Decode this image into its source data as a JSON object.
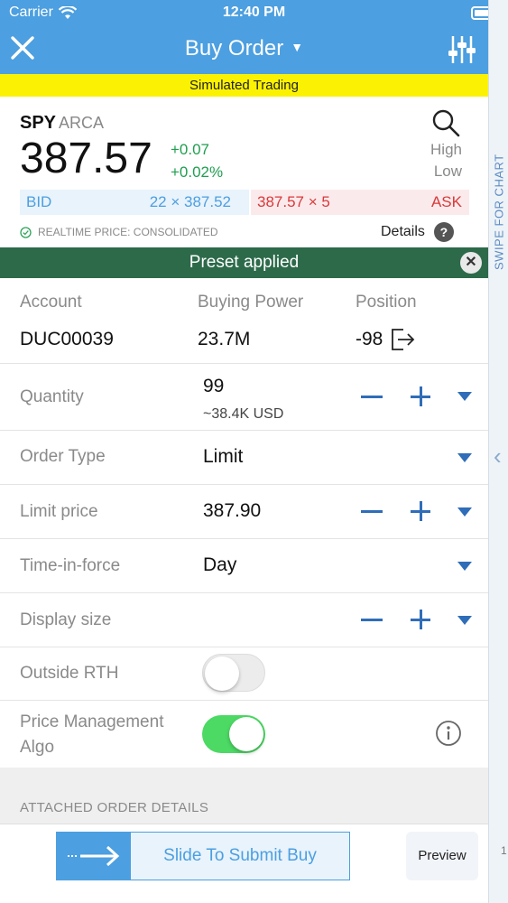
{
  "status_bar": {
    "carrier": "Carrier",
    "time": "12:40 PM"
  },
  "header": {
    "title": "Buy Order",
    "banner": "Simulated Trading"
  },
  "quote": {
    "symbol": "SPY",
    "exchange": "ARCA",
    "price": "387.57",
    "change": "+0.07",
    "change_pct": "+0.02%",
    "high_label": "High",
    "low_label": "Low",
    "bid_label": "BID",
    "bid_value": "22 × 387.52",
    "ask_value": "387.57 × 5",
    "ask_label": "ASK",
    "realtime_label": "REALTIME PRICE: CONSOLIDATED",
    "details_label": "Details"
  },
  "preset_banner": "Preset applied",
  "account": {
    "account_label": "Account",
    "account_value": "DUC00039",
    "buying_power_label": "Buying Power",
    "buying_power_value": "23.7M",
    "position_label": "Position",
    "position_value": "-98"
  },
  "form": {
    "quantity_label": "Quantity",
    "quantity_value": "99",
    "quantity_sub": "~38.4K USD",
    "order_type_label": "Order Type",
    "order_type_value": "Limit",
    "limit_price_label": "Limit price",
    "limit_price_value": "387.90",
    "tif_label": "Time-in-force",
    "tif_value": "Day",
    "display_size_label": "Display size",
    "outside_rth_label": "Outside RTH",
    "outside_rth_on": false,
    "price_mgmt_label_1": "Price Management",
    "price_mgmt_label_2": "Algo",
    "price_mgmt_on": true
  },
  "attached_section": "ATTACHED ORDER DETAILS",
  "bottom": {
    "slide_text": "Slide To Submit Buy",
    "preview_label": "Preview"
  },
  "side_panel": {
    "swipe_text": "SWIPE FOR CHART",
    "mini_label": "1"
  },
  "colors": {
    "header_blue": "#4c9fe0",
    "banner_yellow": "#fbf203",
    "preset_green": "#2d6a4a",
    "up_green": "#1f9e4f",
    "ask_red": "#d83a3a",
    "toggle_green": "#4cd964"
  },
  "icons": [
    "wifi-icon",
    "battery-icon",
    "close-icon",
    "sliders-icon",
    "search-icon",
    "check-circle-icon",
    "help-icon",
    "close-circle-icon",
    "exit-position-icon",
    "minus-icon",
    "plus-icon",
    "dropdown-icon",
    "info-icon",
    "arrow-right-icon"
  ]
}
